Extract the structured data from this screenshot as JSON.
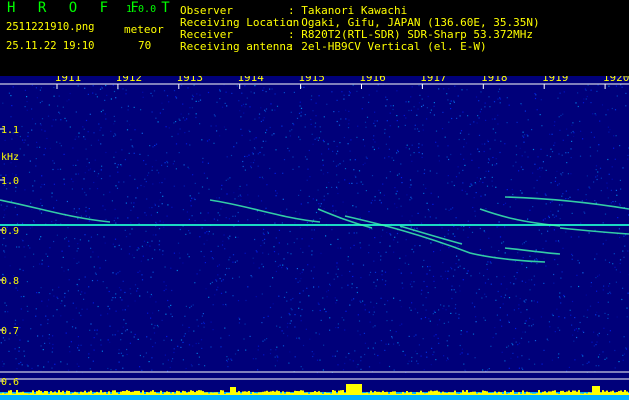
{
  "app": {
    "title": "H R O F F T",
    "version": "1.0.0"
  },
  "file": {
    "name": "2511221910.png",
    "datetime": "25.11.22 19:10"
  },
  "meteor": {
    "label": "meteor",
    "count": "70"
  },
  "info": [
    {
      "label": "Observer",
      "value": ": Takanori Kawachi"
    },
    {
      "label": "Receiving Location",
      "value": ": Ogaki, Gifu, JAPAN (136.60E, 35.35N)"
    },
    {
      "label": "Receiver",
      "value": ": R820T2(RTL-SDR) SDR-Sharp 53.372MHz"
    },
    {
      "label": "Receiving antenna",
      "value": ": 2el-HB9CV Vertical (el. E-W)"
    }
  ],
  "spectrogram": {
    "y_unit": "kHz",
    "x_ticks": [
      "1911",
      "1912",
      "1913",
      "1914",
      "1915",
      "1916",
      "1917",
      "1918",
      "1919",
      "1920"
    ],
    "y_ticks": [
      "1.1",
      "1.0",
      "0.9",
      "0.8",
      "0.7",
      "0.6"
    ],
    "colors": {
      "background": "#00007a",
      "axis": "#ffffff",
      "level": "#ffff00",
      "baseline": "#00b0ff"
    }
  }
}
